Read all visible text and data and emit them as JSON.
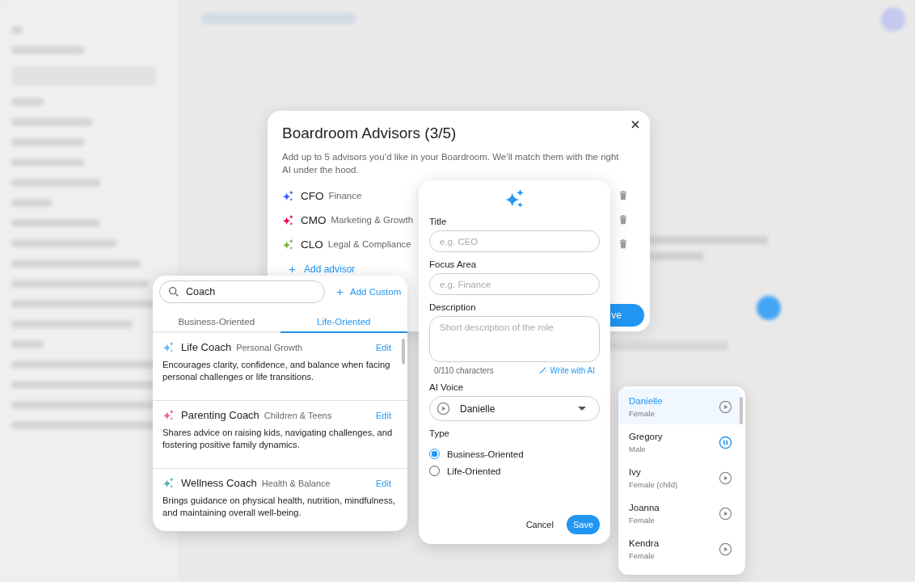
{
  "dialog": {
    "title": "Boardroom Advisors (3/5)",
    "description": "Add up to 5 advisors you’d like in your Boardroom. We’ll match them with the right AI under the hood.",
    "advisors": [
      {
        "title": "CFO",
        "area": "Finance",
        "color": "#3d5afe"
      },
      {
        "title": "CMO",
        "area": "Marketing & Growth",
        "color": "#f50057"
      },
      {
        "title": "CLO",
        "area": "Legal & Compliance",
        "color": "#7cb342"
      }
    ],
    "add_label": "Add advisor",
    "save_label": "ve"
  },
  "picker": {
    "search": {
      "value": "Coach"
    },
    "add_custom": "Add Custom",
    "tabs": [
      {
        "label": "Business-Oriented",
        "selected": false
      },
      {
        "label": "Life-Oriented",
        "selected": true
      }
    ],
    "items": [
      {
        "title": "Life Coach",
        "area": "Personal Growth",
        "color": "#64b5f6",
        "edit": "Edit",
        "description": "Encourages clarity, confidence, and balance when facing personal challenges or life transitions."
      },
      {
        "title": "Parenting Coach",
        "area": "Children & Teens",
        "color": "#f06292",
        "edit": "Edit",
        "description": "Shares advice on raising kids, navigating challenges, and fostering positive family dynamics."
      },
      {
        "title": "Wellness Coach",
        "area": "Health & Balance",
        "color": "#4db6ac",
        "edit": "Edit",
        "description": "Brings guidance on physical health, nutrition, mindfulness, and maintaining overall well-being."
      }
    ]
  },
  "form": {
    "title": {
      "label": "Title",
      "placeholder": "e.g. CEO"
    },
    "focus": {
      "label": "Focus Area",
      "placeholder": "e.g. Finance"
    },
    "description": {
      "label": "Description",
      "placeholder": "Short description of the role",
      "counter": "0/110 characters",
      "write_ai": "Write with AI"
    },
    "voice": {
      "label": "AI Voice",
      "value": "Danielle"
    },
    "type": {
      "label": "Type",
      "options": [
        {
          "label": "Business-Oriented",
          "selected": true
        },
        {
          "label": "Life-Oriented",
          "selected": false
        }
      ]
    },
    "cancel": "Cancel",
    "save": "Save"
  },
  "voices": [
    {
      "name": "Danielle",
      "gender": "Female",
      "selected": true,
      "playing": false
    },
    {
      "name": "Gregory",
      "gender": "Male",
      "selected": false,
      "playing": true
    },
    {
      "name": "Ivy",
      "gender": "Female (child)",
      "selected": false,
      "playing": false
    },
    {
      "name": "Joanna",
      "gender": "Female",
      "selected": false,
      "playing": false
    },
    {
      "name": "Kendra",
      "gender": "Female",
      "selected": false,
      "playing": false
    }
  ]
}
